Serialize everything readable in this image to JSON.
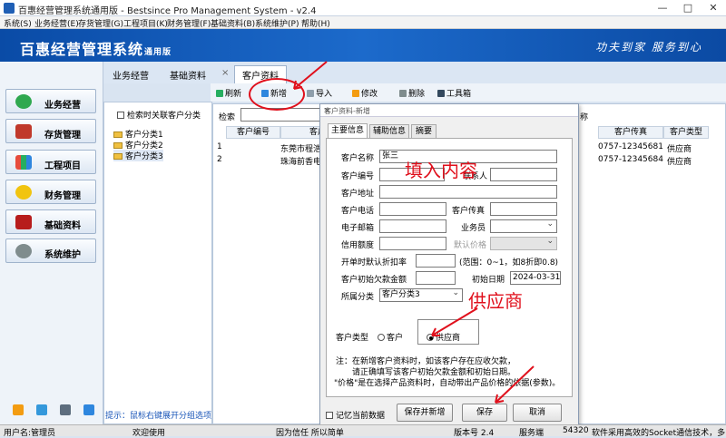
{
  "window": {
    "title": "百惠经营管理系统通用版 - Bestsince Pro Management System - v2.4",
    "controls": [
      "—",
      "□",
      "✕"
    ]
  },
  "menu": [
    "系统(S)",
    "业务经营(E)",
    "存货管理(G)",
    "工程项目(K)",
    "财务管理(F)",
    "基础资料(B)",
    "系统维护(P)",
    "帮助(H)"
  ],
  "banner": {
    "brand": "百惠经营管理系统",
    "edition": "通用版",
    "slogan": "功夫到家 服务到心"
  },
  "nav": [
    "业务经营",
    "存货管理",
    "工程项目",
    "财务管理",
    "基础资料",
    "系统维护"
  ],
  "tabs": [
    "业务经营",
    "基础资料",
    "客户资料"
  ],
  "tab_close": "×",
  "toolbar": [
    "刷新",
    "新增",
    "导入",
    "修改",
    "删除",
    "工具箱"
  ],
  "left": {
    "checkbox_label": "检索时关联客户分类",
    "tree": [
      "客户分类1",
      "客户分类2",
      "客户分类3"
    ],
    "hint": "提示：鼠标右键展开分组选项"
  },
  "grid": {
    "search_label": "检索",
    "columns": [
      "客户编号",
      "客户名称",
      "客户传真",
      "客户类型"
    ],
    "col_partial": "称",
    "rows": [
      {
        "no": "1",
        "name": "东莞市程浩",
        "fax": "0757-12345681",
        "type": "供应商"
      },
      {
        "no": "2",
        "name": "珠海前香电",
        "fax": "0757-12345684",
        "type": "供应商"
      }
    ]
  },
  "dialog": {
    "title": "客户资料-新增",
    "close": "×",
    "tabs": [
      "主要信息",
      "辅助信息",
      "摘要"
    ],
    "fields": {
      "name_label": "客户名称",
      "name_value": "张三",
      "code_label": "客户编号",
      "contact_label": "联系人",
      "address_label": "客户地址",
      "phone_label": "客户电话",
      "fax_label": "客户传真",
      "email_label": "电子邮箱",
      "salesman_label": "业务员",
      "credit_label": "信用额度",
      "price_label": "默认价格",
      "discount_label": "开单时默认折扣率",
      "discount_hint": "(范围：0~1，如8折即0.8)",
      "opening_label": "客户初始欠款金额",
      "date_label": "初始日期",
      "date_value": "2024-03-31",
      "category_label": "所属分类",
      "category_value": "客户分类3",
      "type_label": "客户类型",
      "type_customer": "客户",
      "type_supplier": "供应商"
    },
    "notes": [
      "注：在新增客户资料时，如该客户存在应收欠款，",
      "请正确填写该客户初始欠款金额和初始日期。",
      "\"价格\"是在选择产品资料时，自动带出产品价格的依据(参数)。"
    ],
    "remember": "记忆当前数据",
    "buttons": [
      "保存并新增",
      "保存",
      "取消"
    ]
  },
  "annotations": {
    "fill": "填入内容",
    "supplier": "供应商"
  },
  "status": {
    "user": "用户名:管理员",
    "welcome": "欢迎使用",
    "motto": "因为信任 所以简单",
    "version": "版本号 2.4",
    "server_label": "服务端",
    "port": "54320",
    "socket": "软件采用高效的Socket通信技术，多"
  },
  "colors": {
    "banner": "#0a4ba6",
    "annotation": "#e0101c",
    "hint": "#1a56b8"
  }
}
